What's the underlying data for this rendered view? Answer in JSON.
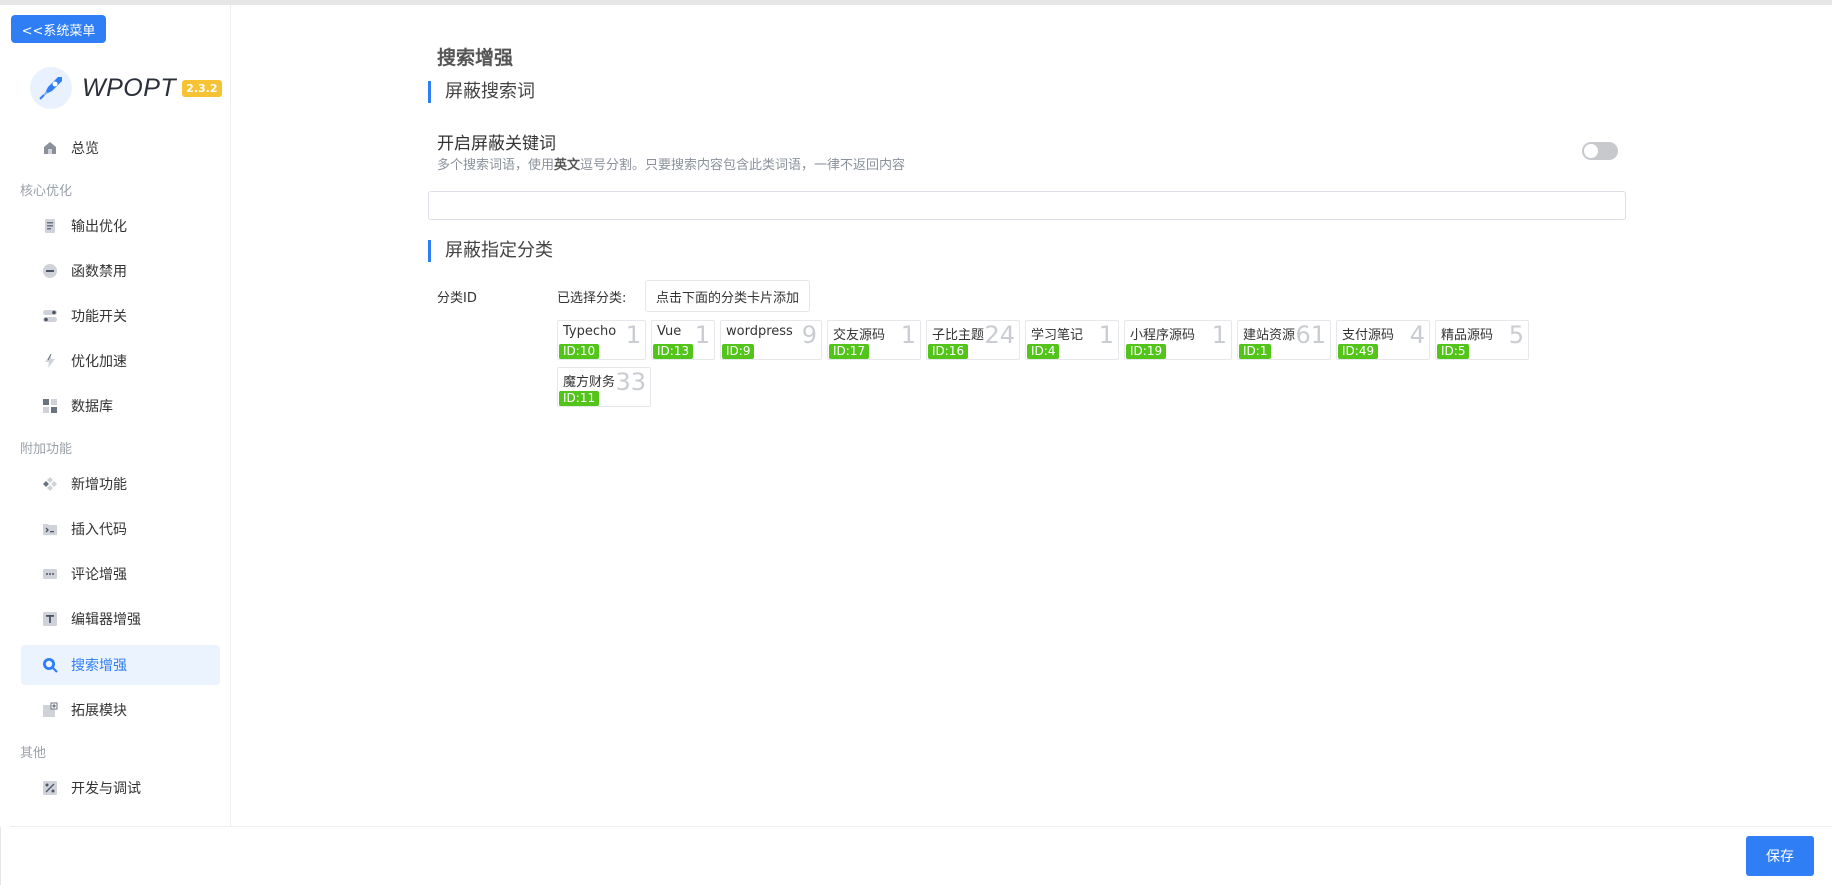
{
  "sidebar": {
    "system_menu_label": "<<系统菜单",
    "logo_text": "WPOPT",
    "version": "2.3.2",
    "items": [
      {
        "label": "总览",
        "icon": "home-icon"
      },
      {
        "label": "输出优化",
        "icon": "file-icon"
      },
      {
        "label": "函数禁用",
        "icon": "minus-circle-icon"
      },
      {
        "label": "功能开关",
        "icon": "toggles-icon"
      },
      {
        "label": "优化加速",
        "icon": "lightning-icon"
      },
      {
        "label": "数据库",
        "icon": "grid-icon"
      },
      {
        "label": "新增功能",
        "icon": "plugin-icon"
      },
      {
        "label": "插入代码",
        "icon": "terminal-folder-icon"
      },
      {
        "label": "评论增强",
        "icon": "comment-dots-icon"
      },
      {
        "label": "编辑器增强",
        "icon": "text-t-icon"
      },
      {
        "label": "搜索增强",
        "icon": "search-icon"
      },
      {
        "label": "拓展模块",
        "icon": "add-module-icon"
      },
      {
        "label": "开发与调试",
        "icon": "percent-icon"
      }
    ],
    "groups": [
      "核心优化",
      "附加功能",
      "其他"
    ],
    "active_item": "搜索增强"
  },
  "main": {
    "page_title": "搜索增强",
    "section1_title": "屏蔽搜索词",
    "field_title": "开启屏蔽关键词",
    "field_desc_before": "多个搜索词语，使用",
    "field_desc_bold": "英文",
    "field_desc_after": "逗号分割。只要搜索内容包含此类词语，一律不返回内容",
    "toggle_on": false,
    "keywords_value": "",
    "section2_title": "屏蔽指定分类",
    "category_label": "分类ID",
    "selected_label": "已选择分类:",
    "add_hint": "点击下面的分类卡片添加",
    "categories": [
      {
        "name": "Typecho",
        "count": "1",
        "id": "ID:10"
      },
      {
        "name": "Vue",
        "count": "1",
        "id": "ID:13"
      },
      {
        "name": "wordpress",
        "count": "9",
        "id": "ID:9"
      },
      {
        "name": "交友源码",
        "count": "1",
        "id": "ID:17"
      },
      {
        "name": "子比主题",
        "count": "24",
        "id": "ID:16"
      },
      {
        "name": "学习笔记",
        "count": "1",
        "id": "ID:4"
      },
      {
        "name": "小程序源码",
        "count": "1",
        "id": "ID:19"
      },
      {
        "name": "建站资源",
        "count": "61",
        "id": "ID:1"
      },
      {
        "name": "支付源码",
        "count": "4",
        "id": "ID:49"
      },
      {
        "name": "精品源码",
        "count": "5",
        "id": "ID:5"
      },
      {
        "name": "魔方财务",
        "count": "33",
        "id": "ID:11"
      }
    ]
  },
  "footer": {
    "save_label": "保存"
  },
  "colors": {
    "accent": "#2f7ef5",
    "id_badge": "#52c41a",
    "version_badge": "#f7c233"
  }
}
